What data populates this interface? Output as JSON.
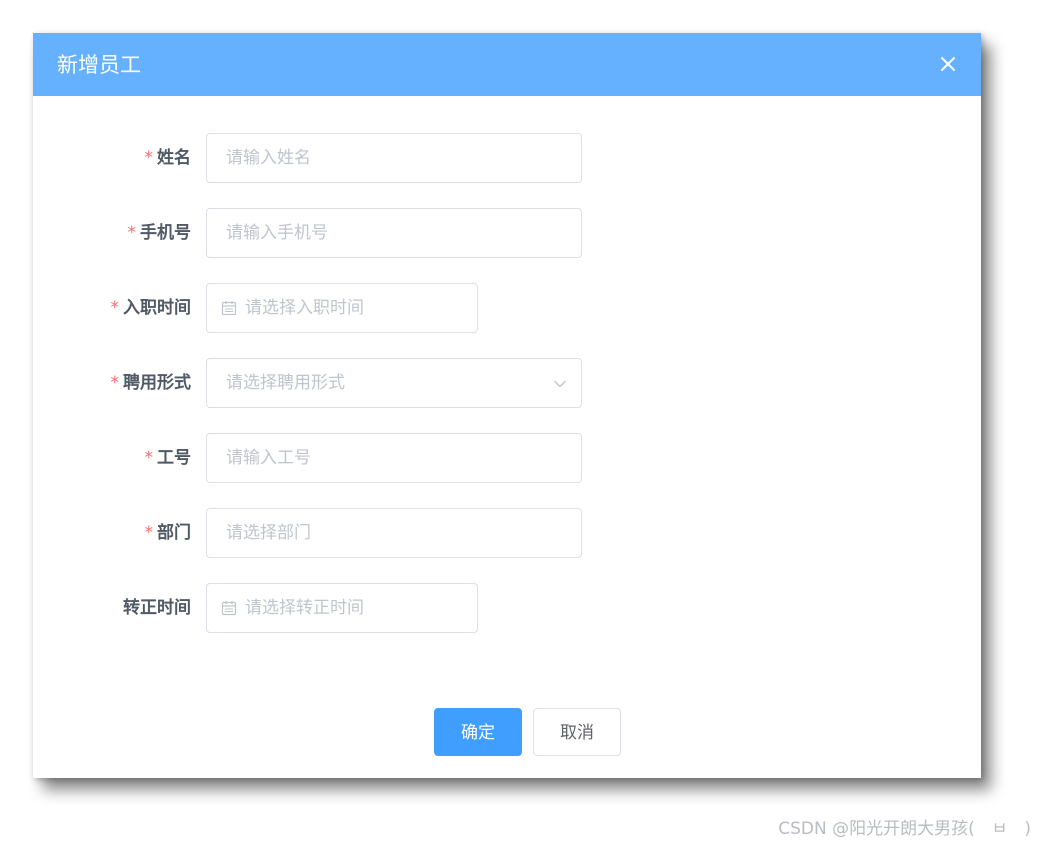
{
  "dialog": {
    "title": "新增员工"
  },
  "form": {
    "name": {
      "required_mark": "*",
      "label": "姓名",
      "placeholder": "请输入姓名",
      "value": ""
    },
    "phone": {
      "required_mark": "*",
      "label": "手机号",
      "placeholder": "请输入手机号",
      "value": ""
    },
    "hire_date": {
      "required_mark": "*",
      "label": "入职时间",
      "placeholder": "请选择入职时间",
      "value": ""
    },
    "employment_type": {
      "required_mark": "*",
      "label": "聘用形式",
      "placeholder": "请选择聘用形式",
      "value": ""
    },
    "employee_id": {
      "required_mark": "*",
      "label": "工号",
      "placeholder": "请输入工号",
      "value": ""
    },
    "department": {
      "required_mark": "*",
      "label": "部门",
      "placeholder": "请选择部门",
      "value": ""
    },
    "regularization_date": {
      "label": "转正时间",
      "placeholder": "请选择转正时间",
      "value": ""
    }
  },
  "footer": {
    "confirm_label": "确定",
    "cancel_label": "取消"
  },
  "watermark": {
    "text": "CSDN @阳光开朗大男孩(　ㅂ　)"
  },
  "icons": {
    "close": "close-icon",
    "calendar": "calendar-icon",
    "chevron": "chevron-down-icon"
  },
  "colors": {
    "header_bg": "#66b1ff",
    "primary": "#409eff",
    "required": "#f56c6c",
    "placeholder": "#c0c4cc",
    "border": "#dcdfe6"
  }
}
